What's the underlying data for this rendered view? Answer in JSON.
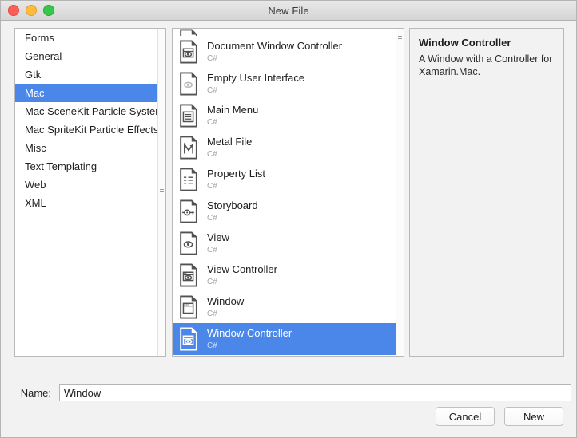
{
  "window": {
    "title": "New File",
    "traffic_lights": [
      {
        "name": "close-button",
        "color": "#fc5f57"
      },
      {
        "name": "minimize-button",
        "color": "#fdbc40"
      },
      {
        "name": "maximize-button",
        "color": "#34c749"
      }
    ]
  },
  "colors": {
    "selection_blue": "#4a87e8",
    "panel_bg": "#f2f2f2",
    "list_bg": "#ffffff",
    "border": "#b9b9b9",
    "muted_text": "#a2a2a2"
  },
  "categories": {
    "selected": "Mac",
    "items": [
      {
        "label": "Forms",
        "selected": false
      },
      {
        "label": "General",
        "selected": false
      },
      {
        "label": "Gtk",
        "selected": false
      },
      {
        "label": "Mac",
        "selected": true
      },
      {
        "label": "Mac SceneKit Particle Systems",
        "selected": false
      },
      {
        "label": "Mac SpriteKit Particle Effects",
        "selected": false
      },
      {
        "label": "Misc",
        "selected": false
      },
      {
        "label": "Text Templating",
        "selected": false
      },
      {
        "label": "Web",
        "selected": false
      },
      {
        "label": "XML",
        "selected": false
      }
    ]
  },
  "templates": {
    "selected": "Window Controller",
    "items": [
      {
        "label": "",
        "lang": "",
        "icon": "document-window-controller-icon",
        "selected": false,
        "clipped": true
      },
      {
        "label": "Document Window Controller",
        "lang": "C#",
        "icon": "document-window-controller-icon",
        "selected": false
      },
      {
        "label": "Empty User Interface",
        "lang": "C#",
        "icon": "empty-user-interface-icon",
        "selected": false
      },
      {
        "label": "Main Menu",
        "lang": "C#",
        "icon": "main-menu-icon",
        "selected": false
      },
      {
        "label": "Metal File",
        "lang": "C#",
        "icon": "metal-file-icon",
        "selected": false
      },
      {
        "label": "Property List",
        "lang": "C#",
        "icon": "property-list-icon",
        "selected": false
      },
      {
        "label": "Storyboard",
        "lang": "C#",
        "icon": "storyboard-icon",
        "selected": false
      },
      {
        "label": "View",
        "lang": "C#",
        "icon": "view-icon",
        "selected": false
      },
      {
        "label": "View Controller",
        "lang": "C#",
        "icon": "view-controller-icon",
        "selected": false
      },
      {
        "label": "Window",
        "lang": "C#",
        "icon": "window-icon",
        "selected": false
      },
      {
        "label": "Window Controller",
        "lang": "C#",
        "icon": "window-controller-icon",
        "selected": true
      }
    ]
  },
  "details": {
    "title": "Window Controller",
    "description": "A Window with a Controller for Xamarin.Mac."
  },
  "name_field": {
    "label": "Name:",
    "value": "Window",
    "placeholder": ""
  },
  "buttons": {
    "cancel": "Cancel",
    "new": "New"
  }
}
